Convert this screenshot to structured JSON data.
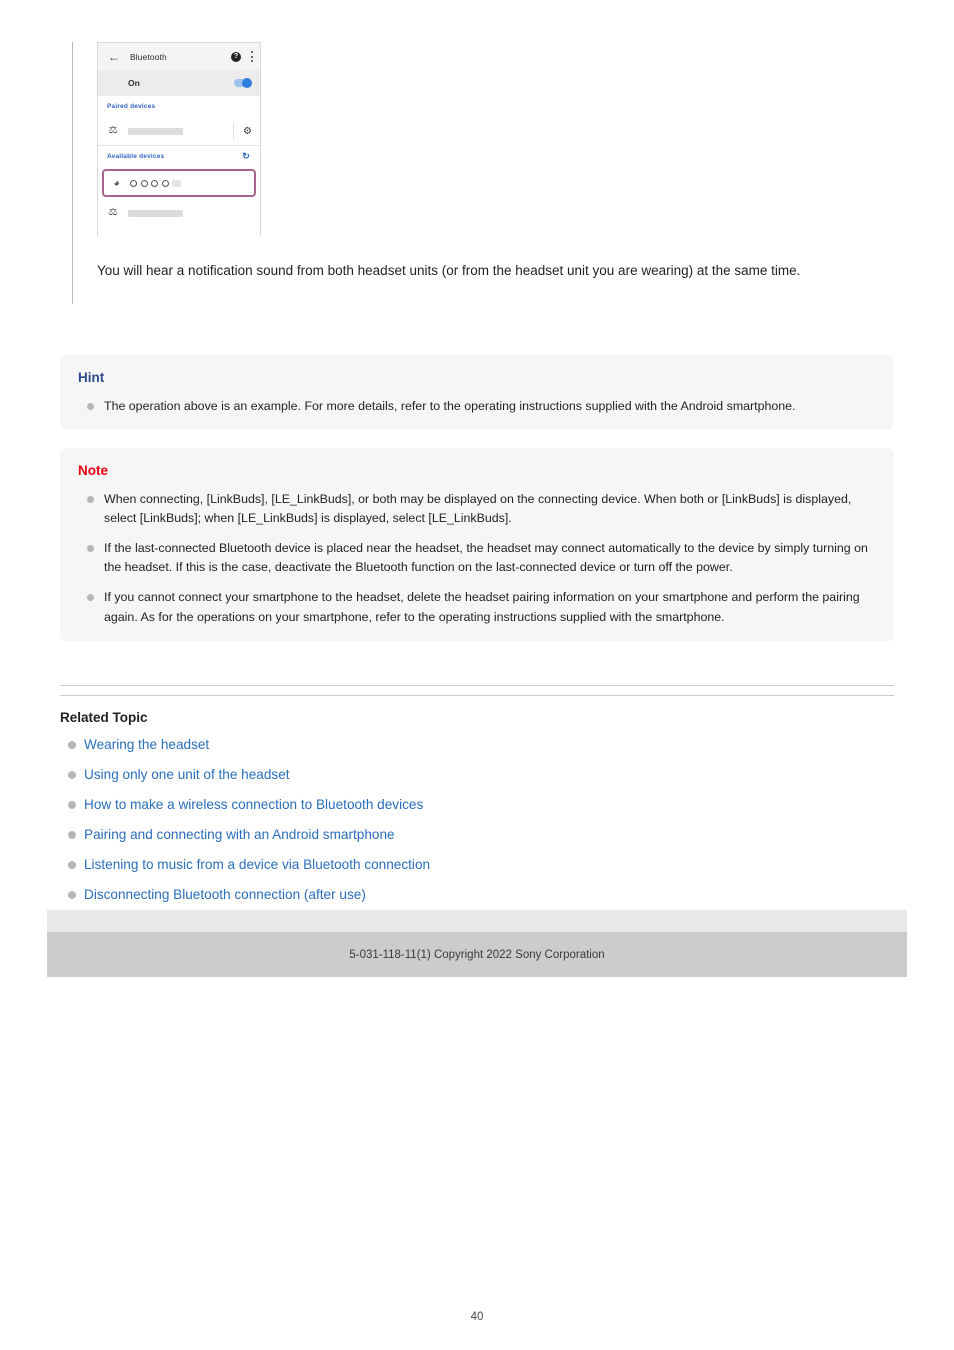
{
  "step": {
    "phone_screenshot": {
      "app_bar": {
        "back_icon": "back-arrow-icon",
        "title": "Bluetooth",
        "help_icon_label": "?",
        "overflow_icon": "kebab-menu-icon"
      },
      "toggle_row": {
        "label": "On",
        "state": "on"
      },
      "sections": [
        {
          "header": "Paired devices",
          "action_icon": ""
        },
        {
          "header": "Available devices",
          "action_icon": "refresh-icon"
        }
      ],
      "paired_device": {
        "icon": "bluetooth-icon",
        "name_redacted": true,
        "settings_icon": "gear-icon"
      },
      "highlighted_device": {
        "icon": "headphones-icon",
        "name_masked": "○○○○",
        "highlight_color": "#a8638f"
      },
      "available_device": {
        "icon": "bluetooth-icon",
        "name_redacted": true
      }
    },
    "text": "You will hear a notification sound from both headset units (or from the headset unit you are wearing) at the same time."
  },
  "hint": {
    "title": "Hint",
    "title_color": "#2c4a8c",
    "items": [
      "The operation above is an example. For more details, refer to the operating instructions supplied with the Android smartphone."
    ]
  },
  "note": {
    "title": "Note",
    "title_color": "#e60012",
    "items": [
      "When connecting, [LinkBuds], [LE_LinkBuds], or both may be displayed on the connecting device. When both or [LinkBuds] is displayed, select [LinkBuds]; when [LE_LinkBuds] is displayed, select [LE_LinkBuds].",
      "If the last-connected Bluetooth device is placed near the headset, the headset may connect automatically to the device by simply turning on the headset. If this is the case, deactivate the Bluetooth function on the last-connected device or turn off the power.",
      "If you cannot connect your smartphone to the headset, delete the headset pairing information on your smartphone and perform the pairing again. As for the operations on your smartphone, refer to the operating instructions supplied with the smartphone."
    ]
  },
  "related": {
    "title": "Related Topic",
    "link_color": "#2a6ebb",
    "links": [
      "Wearing the headset",
      "Using only one unit of the headset",
      "How to make a wireless connection to Bluetooth devices",
      "Pairing and connecting with an Android smartphone",
      "Listening to music from a device via Bluetooth connection",
      "Disconnecting Bluetooth connection (after use)"
    ]
  },
  "footer": {
    "copyright": "5-031-118-11(1) Copyright 2022 Sony Corporation"
  },
  "page_number": "40"
}
